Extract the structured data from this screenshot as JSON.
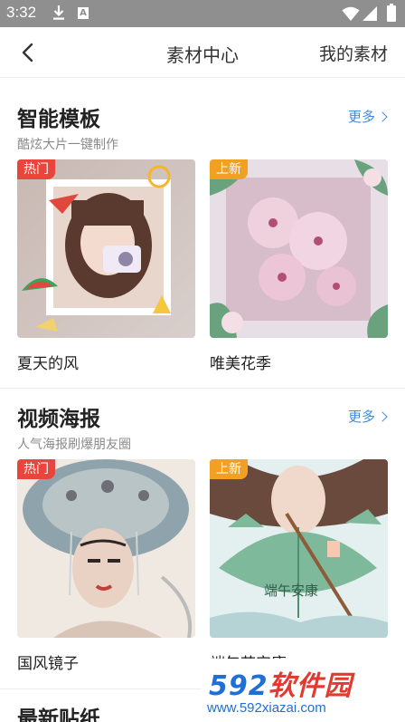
{
  "status_bar": {
    "time": "3:32",
    "icons": [
      "download-icon",
      "a-notification-icon",
      "wifi-icon",
      "signal-icon",
      "battery-icon"
    ]
  },
  "nav": {
    "title": "素材中心",
    "right_label": "我的素材"
  },
  "sections": [
    {
      "title": "智能模板",
      "subtitle": "酷炫大片一键制作",
      "more": "更多",
      "cards": [
        {
          "tag": "热门",
          "tag_color": "#e8463c",
          "caption": "夏天的风"
        },
        {
          "tag": "上新",
          "tag_color": "#f2a023",
          "caption": "唯美花季"
        }
      ]
    },
    {
      "title": "视频海报",
      "subtitle": "人气海报刷爆朋友圈",
      "more": "更多",
      "cards": [
        {
          "tag": "热门",
          "tag_color": "#e8463c",
          "caption": "国风镜子"
        },
        {
          "tag": "上新",
          "tag_color": "#f2a023",
          "caption": "端午节安康",
          "thumb_text": "端午安康"
        }
      ]
    },
    {
      "title": "最新贴纸"
    }
  ],
  "watermark": {
    "brand": "592",
    "brand_suffix": "软件园",
    "url": "www.592xiazai.com"
  }
}
